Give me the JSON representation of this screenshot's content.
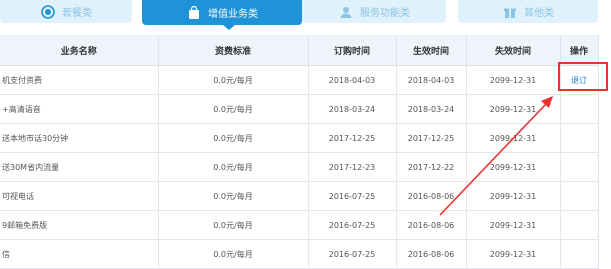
{
  "tabs": [
    {
      "label": "套餐类",
      "icon": "check-circle-icon",
      "active": false
    },
    {
      "label": "增值业务类",
      "icon": "shopping-bag-icon",
      "active": true
    },
    {
      "label": "服务功能类",
      "icon": "service-person-icon",
      "active": false
    },
    {
      "label": "其他类",
      "icon": "gift-icon",
      "active": false
    }
  ],
  "table": {
    "headers": [
      "业务名称",
      "资费标准",
      "订购时间",
      "生效时间",
      "失效时间",
      "操作"
    ],
    "rows": [
      {
        "name": "机支付资费",
        "fee": "0.0元/每月",
        "ordered": "2018-04-03",
        "effective": "2018-04-03",
        "expires": "2099-12-31",
        "action": "退订"
      },
      {
        "name": "+高清语音",
        "fee": "0.0元/每月",
        "ordered": "2018-03-24",
        "effective": "2018-03-24",
        "expires": "2099-12-31",
        "action": ""
      },
      {
        "name": "送本地市话30分钟",
        "fee": "0.0元/每月",
        "ordered": "2017-12-25",
        "effective": "2017-12-25",
        "expires": "2099-12-31",
        "action": ""
      },
      {
        "name": "送30M省内流量",
        "fee": "0.0元/每月",
        "ordered": "2017-12-23",
        "effective": "2017-12-22",
        "expires": "2099-12-31",
        "action": ""
      },
      {
        "name": "可视电话",
        "fee": "0.0元/每月",
        "ordered": "2016-07-25",
        "effective": "2016-08-06",
        "expires": "2099-12-31",
        "action": ""
      },
      {
        "name": "9邮箱免费版",
        "fee": "0.0元/每月",
        "ordered": "2016-07-25",
        "effective": "2016-08-06",
        "expires": "2099-12-31",
        "action": ""
      },
      {
        "name": "信",
        "fee": "0.0元/每月",
        "ordered": "2016-07-25",
        "effective": "2016-08-06",
        "expires": "2099-12-31",
        "action": ""
      }
    ]
  },
  "colors": {
    "accent": "#1e93d8",
    "tab_inactive": "#dff1fb",
    "annotation": "#e8322d",
    "link": "#1f7fd1"
  }
}
